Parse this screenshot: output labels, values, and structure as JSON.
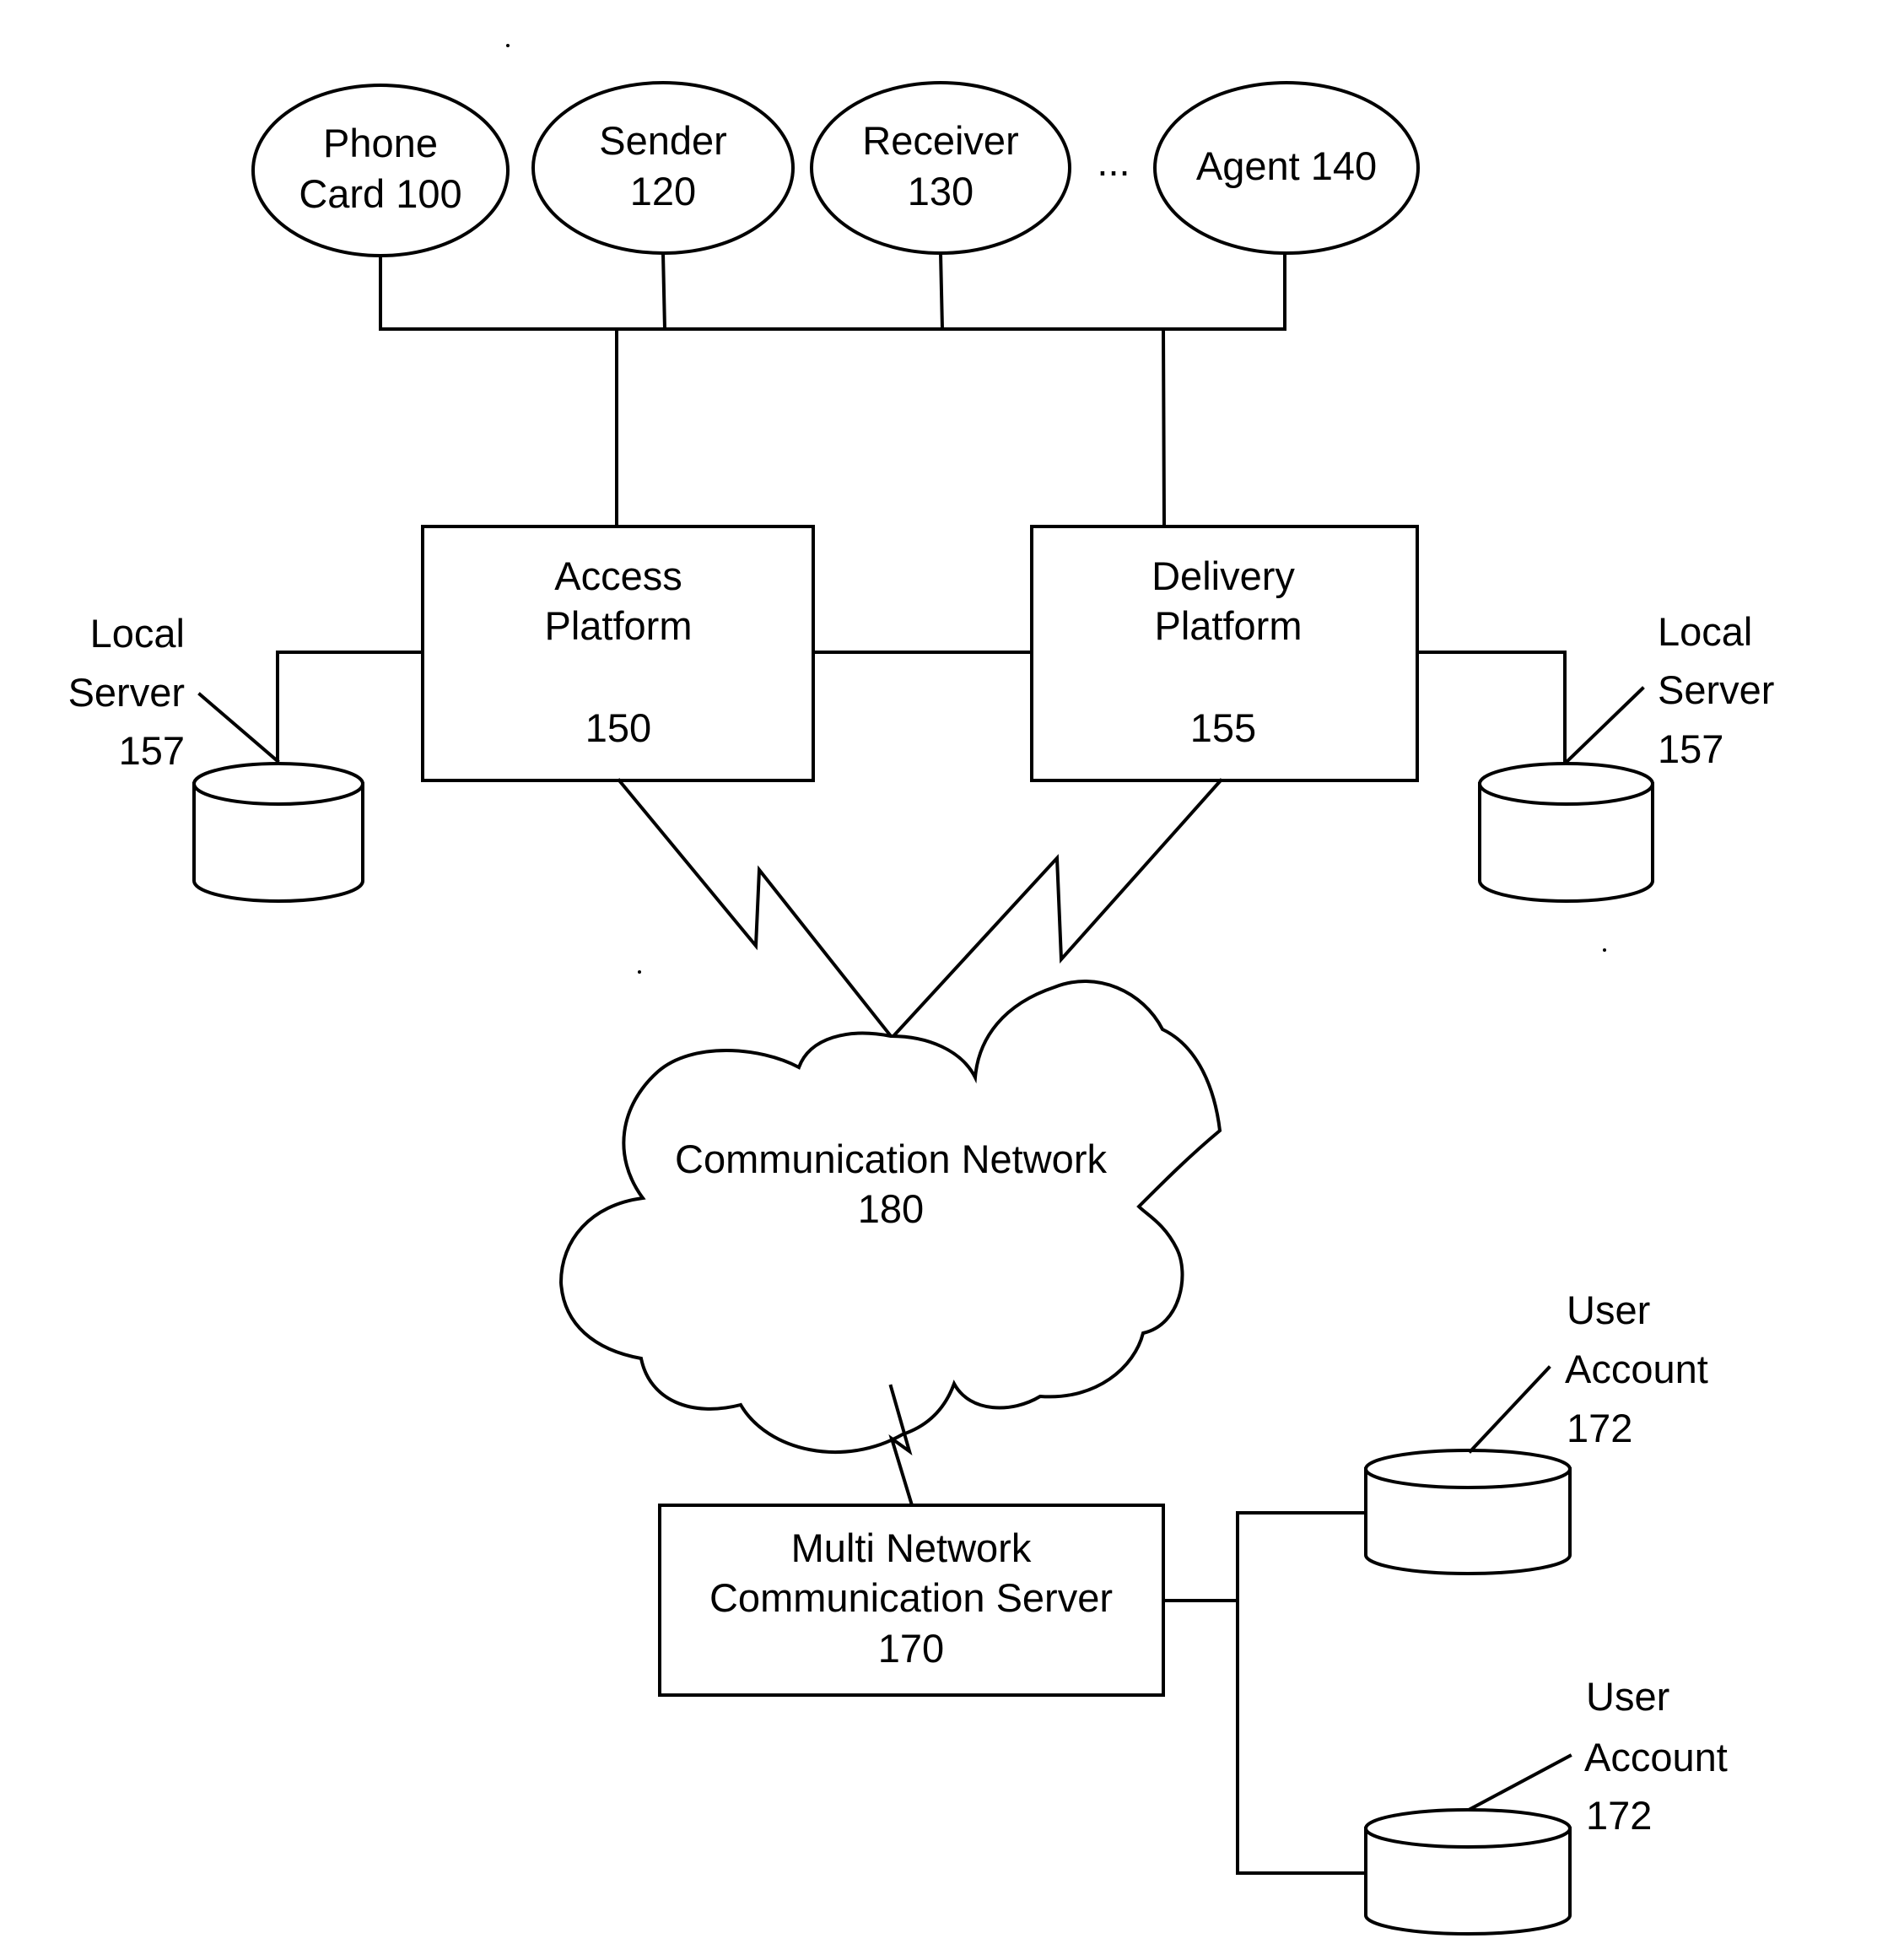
{
  "diagram": {
    "entities": [
      {
        "id": "phone-card",
        "lines": [
          "Phone",
          "Card 100"
        ]
      },
      {
        "id": "sender",
        "lines": [
          "Sender",
          "120"
        ]
      },
      {
        "id": "receiver",
        "lines": [
          "Receiver",
          "130"
        ]
      },
      {
        "id": "agent",
        "lines": [
          "Agent 140"
        ]
      }
    ],
    "ellipsis": "...",
    "access_platform": {
      "lines": [
        "Access",
        "Platform"
      ],
      "number": "150"
    },
    "delivery_platform": {
      "lines": [
        "Delivery",
        "Platform"
      ],
      "number": "155"
    },
    "local_server_left": {
      "lines": [
        "Local",
        "Server",
        "157"
      ]
    },
    "local_server_right": {
      "lines": [
        "Local",
        "Server",
        "157"
      ]
    },
    "network": {
      "lines": [
        "Communication Network",
        "180"
      ]
    },
    "mncs": {
      "lines": [
        "Multi Network",
        "Communication Server",
        "170"
      ]
    },
    "user_account_top": {
      "lines": [
        "User",
        "Account",
        "172"
      ]
    },
    "user_account_bottom": {
      "lines": [
        "User",
        "Account",
        "172"
      ]
    }
  }
}
